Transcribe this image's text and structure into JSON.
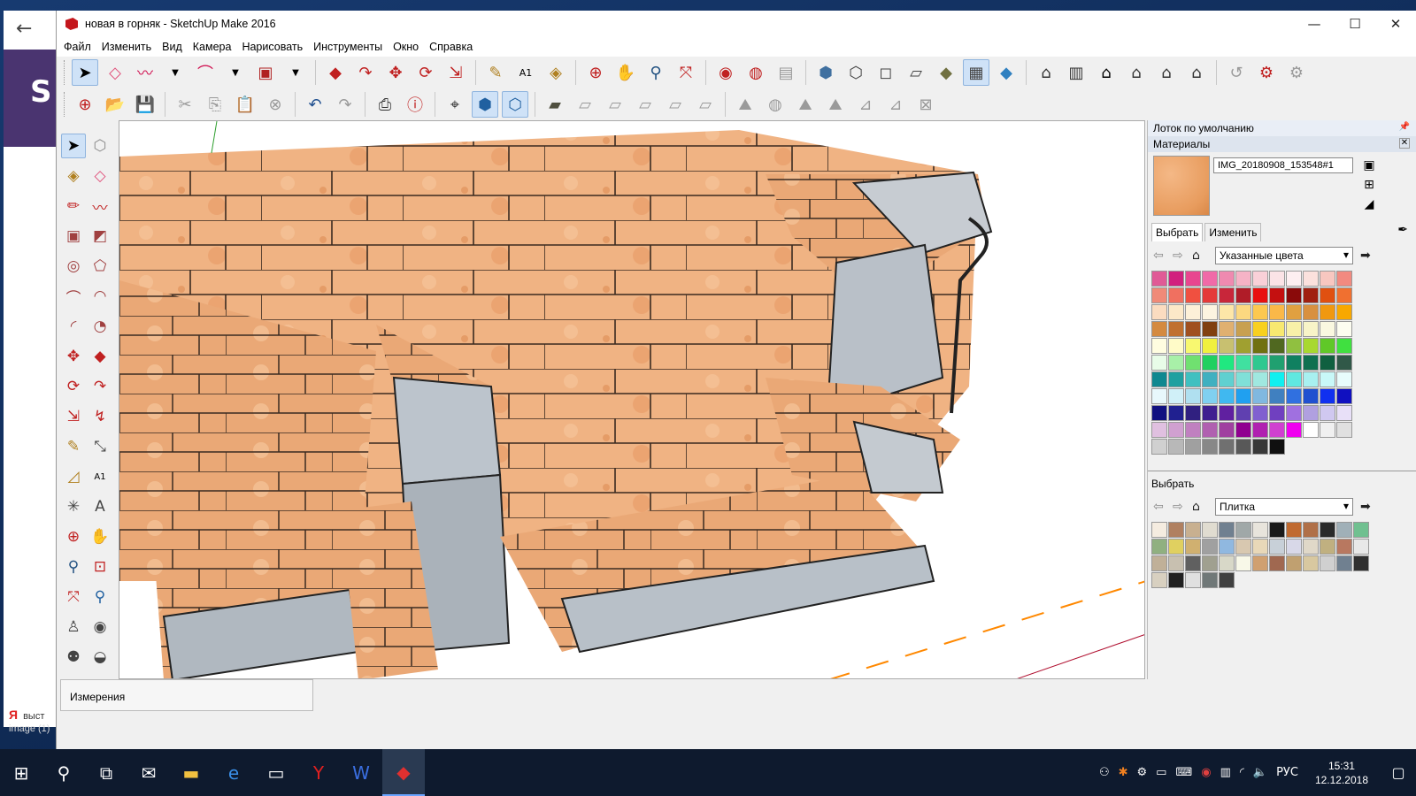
{
  "window": {
    "title": "новая в горняк - SketchUp Make 2016",
    "controls": {
      "min": "—",
      "max": "☐",
      "close": "✕"
    }
  },
  "menu": [
    "Файл",
    "Изменить",
    "Вид",
    "Камера",
    "Нарисовать",
    "Инструменты",
    "Окно",
    "Справка"
  ],
  "statusbar": {
    "measurements_label": "Измерения"
  },
  "tray": {
    "title": "Лоток по умолчанию",
    "materials_header": "Материалы",
    "material_name": "IMG_20180908_153548#1",
    "tabs": [
      "Выбрать",
      "Изменить"
    ],
    "collection1": "Указанные цвета",
    "select_label": "Выбрать",
    "collection2": "Плитка",
    "palette1": [
      [
        "#e05a96",
        "#d1207e",
        "#e8468f",
        "#f06aa8",
        "#ef8ab0",
        "#f6b3c6",
        "#f9d0d8",
        "#fbe3e6",
        "#fdeff1",
        "#fbe1dd",
        "#f8c7c0",
        "#f28a80"
      ],
      [
        "#f08a78",
        "#f07060",
        "#f05040",
        "#e43a3a",
        "#c8263a",
        "#b01c28",
        "#e81010",
        "#c41010",
        "#8a0a0a",
        "#a02010",
        "#e05010",
        "#f07030"
      ],
      [
        "#fbdcc0",
        "#fce8c8",
        "#fdf0d8",
        "#fcf4e0",
        "#fde6a8",
        "#fcd880",
        "#fcc850",
        "#fab848",
        "#e0a040",
        "#d89040",
        "#f09810",
        "#f8a800"
      ],
      [
        "#d48a40",
        "#c07030",
        "#a05020",
        "#804010",
        "#e0b070",
        "#c8a050",
        "#f8d020",
        "#f8e870",
        "#f8f0a8",
        "#f8f4c8",
        "#faf8e0",
        "#fdfdf0"
      ],
      [
        "#fffde0",
        "#fffbc8",
        "#f8f870",
        "#f0f040",
        "#c8c070",
        "#a0a030",
        "#707010",
        "#506820",
        "#90c040",
        "#a8d830",
        "#60c828",
        "#40e040"
      ],
      [
        "#e8fce8",
        "#a8f0a8",
        "#70e070",
        "#20d060",
        "#20e880",
        "#40e0a0",
        "#30c890",
        "#20a070",
        "#108060",
        "#107050",
        "#106040",
        "#305848"
      ],
      [
        "#108890",
        "#20a0a0",
        "#40c0c0",
        "#40b0c0",
        "#60d0d0",
        "#80e0d8",
        "#a0e8e0",
        "#10f0f0",
        "#60e8e0",
        "#a8f0f0",
        "#c8f8f8",
        "#e8fcfc"
      ],
      [
        "#e8f8fc",
        "#d0f0f8",
        "#b0e0f0",
        "#80d0f0",
        "#40b8f0",
        "#20a0f0",
        "#80b8e0",
        "#4080c0",
        "#3070e0",
        "#2050d0",
        "#1030f0",
        "#1010c0"
      ],
      [
        "#101080",
        "#202090",
        "#302080",
        "#402090",
        "#6020a0",
        "#6040b0",
        "#8060d0",
        "#7040c0",
        "#a070e0",
        "#b0a0e0",
        "#d0c8f0",
        "#e8e0f8"
      ],
      [
        "#e0c0e0",
        "#d0a0d0",
        "#c080c0",
        "#b060b0",
        "#a040a0",
        "#900090",
        "#b020b0",
        "#d040d0",
        "#f000f0",
        "#ffffff",
        "#f0f0f0",
        "#e0e0e0"
      ],
      [
        "#d0d0d0",
        "#b8b8b8",
        "#a0a0a0",
        "#888888",
        "#707070",
        "#585858",
        "#383838",
        "#101010"
      ]
    ],
    "palette2": [
      [
        "#f5ece0",
        "#b08060",
        "#c8b090",
        "#e0dcd0",
        "#708090",
        "#a0a8a8",
        "#e8e4dc",
        "#1a1a1a",
        "#c06a30",
        "#b07048",
        "#2a2a2a",
        "#a0b0b8",
        "#70c090"
      ],
      [
        "#90b080",
        "#e0d060",
        "#d0b070",
        "#a0a0a0",
        "#90b8e0",
        "#d8c8b0",
        "#e8d8b8",
        "#c8d0d8",
        "#d8d8e8",
        "#e0d8c8",
        "#c0b080",
        "#b87860",
        "#e8e8e8"
      ],
      [
        "#c0b098",
        "#c8c0b0",
        "#606060",
        "#a0a090",
        "#d8d8c8",
        "#f8f8e8",
        "#d0a070",
        "#a06850",
        "#c0a070",
        "#d8c8a0",
        "#d0d0d0",
        "#708090",
        "#303030"
      ],
      [
        "#d8d0c0",
        "#202020",
        "#e0e0e0",
        "#707878",
        "#404040"
      ]
    ]
  },
  "taskbar": {
    "lang": "РУС",
    "time": "15:31",
    "date": "12.12.2018"
  },
  "background_window": {
    "letter": "S",
    "yandex_text": "выст",
    "image_text": "image (1)"
  }
}
